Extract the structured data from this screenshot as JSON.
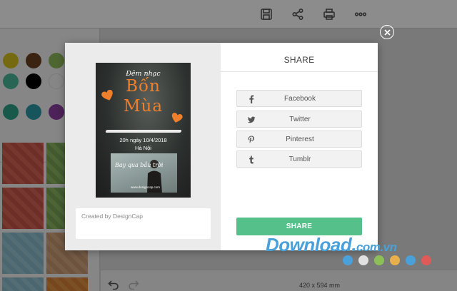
{
  "toolbar": {
    "icons": [
      "save-icon",
      "share-icon",
      "print-icon",
      "more-icon"
    ]
  },
  "left_panel": {
    "color_swatches": [
      "#d8c21e",
      "#6b4320",
      "#8fba5a",
      "#49b89a",
      "#000000",
      "#f4f4f4",
      "#2fa28a",
      "#2b9aa8",
      "#8a3fa0"
    ],
    "pattern_tiles": [
      "red",
      "green",
      "red",
      "green",
      "blue",
      "tan",
      "blue",
      "orange"
    ]
  },
  "canvas": {
    "size_label": "420 x 594 mm"
  },
  "modal": {
    "title": "SHARE",
    "share_options": [
      {
        "label": "Facebook",
        "icon": "facebook-icon"
      },
      {
        "label": "Twitter",
        "icon": "twitter-icon"
      },
      {
        "label": "Pinterest",
        "icon": "pinterest-icon"
      },
      {
        "label": "Tumblr",
        "icon": "tumblr-icon"
      }
    ],
    "share_button": "SHARE",
    "note_text": "Created by DesignCap",
    "poster": {
      "subtitle": "Đêm nhạc",
      "title_line1": "Bốn",
      "title_line2": "Mùa",
      "date": "20h ngày 10/4/2018",
      "location": "Hà Nội",
      "photo_script": "Bay qua bầu trời",
      "photo_site": "www.designcap.com"
    }
  },
  "watermark": {
    "main": "Download",
    "dot": ".",
    "tld": "com.vn",
    "dot_colors": [
      "#4aa0d8",
      "#e0e0e0",
      "#8cc056",
      "#e8b04a",
      "#4aa0d8",
      "#e05a5a"
    ]
  },
  "colors": {
    "accent_green": "#55c08a",
    "poster_orange": "#ef7f2a"
  }
}
